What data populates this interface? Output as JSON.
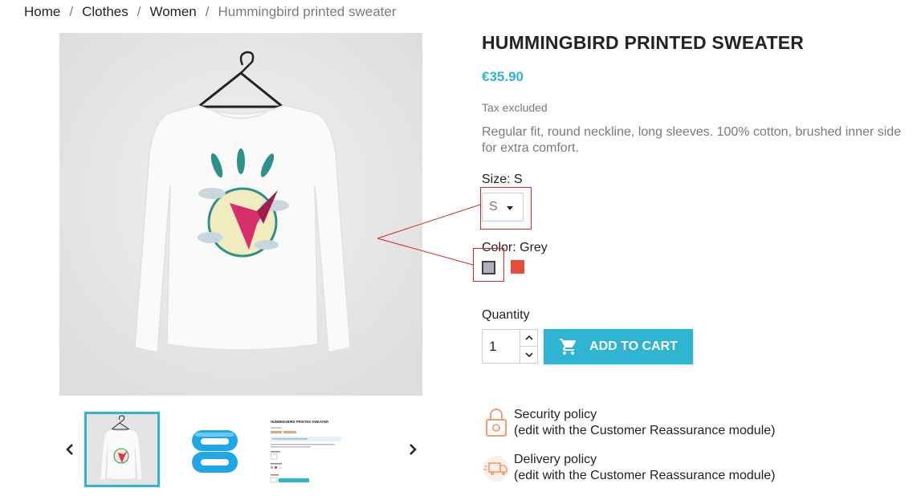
{
  "breadcrumb": {
    "items": [
      "Home",
      "Clothes",
      "Women"
    ],
    "current": "Hummingbird printed sweater",
    "separator": "/"
  },
  "product": {
    "title": "HUMMINGBIRD PRINTED SWEATER",
    "price": "€35.90",
    "tax_note": "Tax excluded",
    "description": "Regular fit, round neckline, long sleeves. 100% cotton, brushed inner side for extra comfort."
  },
  "size": {
    "label": "Size: S",
    "selected": "S"
  },
  "color": {
    "label": "Color: Grey",
    "swatches": [
      {
        "name": "Grey",
        "hex": "#aab2bd",
        "selected": true
      },
      {
        "name": "Red",
        "hex": "#e84c3d",
        "selected": false
      }
    ]
  },
  "quantity": {
    "label": "Quantity",
    "value": "1"
  },
  "cart": {
    "button_label": "ADD TO CART",
    "icon": "shopping-cart-icon"
  },
  "thumbnails": {
    "mini_title": "HUMMINGBIRD PRINTED SWEATER"
  },
  "reassurance": [
    {
      "title": "Security policy",
      "detail": "(edit with the Customer Reassurance module)",
      "icon": "lock-icon"
    },
    {
      "title": "Delivery policy",
      "detail": "(edit with the Customer Reassurance module)",
      "icon": "truck-icon"
    }
  ],
  "colors": {
    "accent": "#2fb5d2",
    "highlight": "#d9262c",
    "text": "#232323",
    "muted": "#7a7a7a"
  }
}
